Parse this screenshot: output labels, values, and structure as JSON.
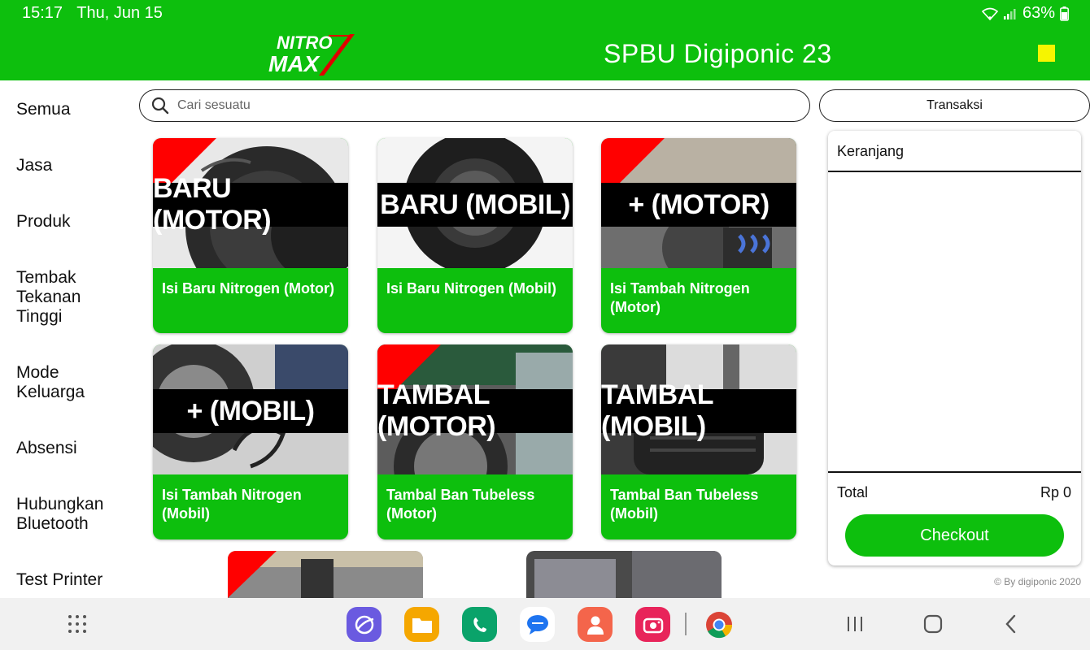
{
  "status_bar": {
    "time": "15:17",
    "date": "Thu, Jun 15",
    "battery": "63%"
  },
  "header": {
    "logo_top": "NITRO",
    "logo_bottom": "MAX",
    "title": "SPBU Digiponic 23",
    "accent": "#0dbf0d"
  },
  "sidebar": {
    "items": [
      {
        "label": "Semua"
      },
      {
        "label": "Jasa"
      },
      {
        "label": "Produk"
      },
      {
        "label": "Tembak\nTekanan\nTinggi"
      },
      {
        "label": "Mode\nKeluarga"
      },
      {
        "label": "Absensi"
      },
      {
        "label": "Hubungkan\nBluetooth"
      },
      {
        "label": "Test Printer"
      }
    ]
  },
  "search": {
    "placeholder": "Cari sesuatu",
    "value": ""
  },
  "transaction_button": "Transaksi",
  "products": [
    {
      "banner": "BARU (MOTOR)",
      "name": "Isi Baru Nitrogen (Motor)",
      "image": "motorcycle tire"
    },
    {
      "banner": "BARU (MOBIL)",
      "name": "Isi Baru Nitrogen (Mobil)",
      "image": "car tire"
    },
    {
      "banner": "+ (MOTOR)",
      "name": "Isi Tambah Nitrogen (Motor)",
      "image": "motorcycle wheel service"
    },
    {
      "banner": "+ (MOBIL)",
      "name": "Isi Tambah Nitrogen (Mobil)",
      "image": "car tire inflation"
    },
    {
      "banner": "TAMBAL (MOTOR)",
      "name": "Tambal Ban Tubeless (Motor)",
      "image": "motorcycle tire repair"
    },
    {
      "banner": "TAMBAL (MOBIL)",
      "name": "Tambal Ban Tubeless (Mobil)",
      "image": "car tire repair"
    }
  ],
  "cart": {
    "title": "Keranjang",
    "total_label": "Total",
    "total_value": "Rp 0",
    "checkout_label": "Checkout"
  },
  "credit": "© By digiponic 2020",
  "navbar": {
    "apps": [
      "apps-grid-icon",
      "internet-icon",
      "files-icon",
      "phone-icon",
      "messages-icon",
      "contacts-icon",
      "camera-icon",
      "chrome-icon"
    ],
    "controls": [
      "recents-icon",
      "home-icon",
      "back-icon"
    ]
  }
}
